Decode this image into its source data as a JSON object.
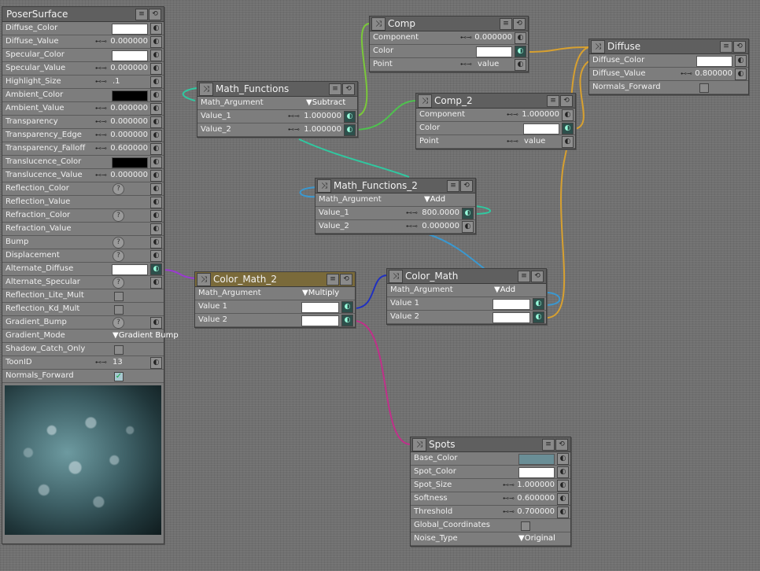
{
  "colors": {
    "wire_yellow": "#d7a030",
    "wire_green": "#4ec24e",
    "wire_teal": "#30c8a0",
    "wire_blue": "#3a98d0",
    "wire_purple": "#9a3ad0",
    "wire_darkblue": "#2030c0",
    "wire_magenta": "#c0308a",
    "color_math_header": "#7a6a3a",
    "spots_base_color": "#6a8e96",
    "ambient_color": "#000000",
    "translucence_color": "#000000"
  },
  "poser_surface": {
    "title": "PoserSurface",
    "rows": {
      "diffuse_color": {
        "label": "Diffuse_Color"
      },
      "diffuse_value": {
        "label": "Diffuse_Value",
        "value": "0.000000"
      },
      "specular_color": {
        "label": "Specular_Color"
      },
      "specular_value": {
        "label": "Specular_Value",
        "value": "0.000000"
      },
      "highlight_size": {
        "label": "Highlight_Size",
        "value": ".1"
      },
      "ambient_color": {
        "label": "Ambient_Color"
      },
      "ambient_value": {
        "label": "Ambient_Value",
        "value": "0.000000"
      },
      "transparency": {
        "label": "Transparency",
        "value": "0.000000"
      },
      "transparency_edge": {
        "label": "Transparency_Edge",
        "value": "0.000000"
      },
      "transparency_falloff": {
        "label": "Transparency_Falloff",
        "value": "0.600000"
      },
      "translucence_color": {
        "label": "Translucence_Color"
      },
      "translucence_value": {
        "label": "Translucence_Value",
        "value": "0.000000"
      },
      "reflection_color": {
        "label": "Reflection_Color"
      },
      "reflection_value": {
        "label": "Reflection_Value"
      },
      "refraction_color": {
        "label": "Refraction_Color"
      },
      "refraction_value": {
        "label": "Refraction_Value"
      },
      "bump": {
        "label": "Bump"
      },
      "displacement": {
        "label": "Displacement"
      },
      "alternate_diffuse": {
        "label": "Alternate_Diffuse"
      },
      "alternate_specular": {
        "label": "Alternate_Specular"
      },
      "reflection_lite_mult": {
        "label": "Reflection_Lite_Mult"
      },
      "reflection_kd_mult": {
        "label": "Reflection_Kd_Mult"
      },
      "gradient_bump": {
        "label": "Gradient_Bump"
      },
      "gradient_mode": {
        "label": "Gradient_Mode",
        "value": "Gradient Bump"
      },
      "shadow_catch_only": {
        "label": "Shadow_Catch_Only"
      },
      "toon_id": {
        "label": "ToonID",
        "value": "13"
      },
      "normals_forward": {
        "label": "Normals_Forward",
        "checked": true
      }
    }
  },
  "math_functions": {
    "title": "Math_Functions",
    "math_argument": {
      "label": "Math_Argument",
      "value": "Subtract"
    },
    "value_1": {
      "label": "Value_1",
      "value": "1.000000"
    },
    "value_2": {
      "label": "Value_2",
      "value": "1.000000"
    }
  },
  "comp": {
    "title": "Comp",
    "component": {
      "label": "Component",
      "value": "0.000000"
    },
    "color": {
      "label": "Color"
    },
    "point": {
      "label": "Point",
      "value": "value"
    }
  },
  "comp_2": {
    "title": "Comp_2",
    "component": {
      "label": "Component",
      "value": "1.000000"
    },
    "color": {
      "label": "Color"
    },
    "point": {
      "label": "Point",
      "value": "value"
    }
  },
  "diffuse": {
    "title": "Diffuse",
    "diffuse_color": {
      "label": "Diffuse_Color"
    },
    "diffuse_value": {
      "label": "Diffuse_Value",
      "value": "0.800000"
    },
    "normals_forward": {
      "label": "Normals_Forward",
      "checked": false
    }
  },
  "math_functions_2": {
    "title": "Math_Functions_2",
    "math_argument": {
      "label": "Math_Argument",
      "value": "Add"
    },
    "value_1": {
      "label": "Value_1",
      "value": "800.0000"
    },
    "value_2": {
      "label": "Value_2",
      "value": "0.000000"
    }
  },
  "color_math_2": {
    "title": "Color_Math_2",
    "math_argument": {
      "label": "Math_Argument",
      "value": "Multiply"
    },
    "value_1": {
      "label": "Value 1"
    },
    "value_2": {
      "label": "Value 2"
    }
  },
  "color_math": {
    "title": "Color_Math",
    "math_argument": {
      "label": "Math_Argument",
      "value": "Add"
    },
    "value_1": {
      "label": "Value 1"
    },
    "value_2": {
      "label": "Value 2"
    }
  },
  "spots": {
    "title": "Spots",
    "base_color": {
      "label": "Base_Color"
    },
    "spot_color": {
      "label": "Spot_Color"
    },
    "spot_size": {
      "label": "Spot_Size",
      "value": "1.000000"
    },
    "softness": {
      "label": "Softness",
      "value": "0.600000"
    },
    "threshold": {
      "label": "Threshold",
      "value": "0.700000"
    },
    "global_coordinates": {
      "label": "Global_Coordinates",
      "checked": false
    },
    "noise_type": {
      "label": "Noise_Type",
      "value": "Original"
    }
  }
}
